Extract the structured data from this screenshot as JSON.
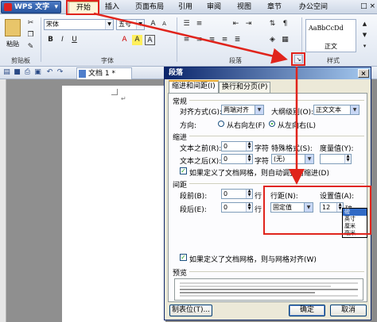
{
  "app": {
    "name": "WPS 文字",
    "caret": "▾"
  },
  "menu": {
    "tabs": [
      {
        "label": "开始",
        "active": true
      },
      {
        "label": "插入"
      },
      {
        "label": "页面布局"
      },
      {
        "label": "引用"
      },
      {
        "label": "审阅"
      },
      {
        "label": "视图"
      },
      {
        "label": "章节"
      },
      {
        "label": "办公空间"
      }
    ],
    "window_controls": "□ ×"
  },
  "ribbon": {
    "paste_label": "粘贴",
    "font_name": "宋体",
    "font_size": "五号",
    "groups": {
      "clipboard": "剪贴板",
      "font": "字体",
      "paragraph": "段落",
      "styles": "样式"
    },
    "style_sample": "AaBbCcDd",
    "style_name": "正文",
    "font_buttons": [
      "B",
      "I",
      "U",
      "A",
      "A",
      "A"
    ]
  },
  "document": {
    "tab_title": "文档 1 *",
    "mark": "↵"
  },
  "dialog": {
    "title": "段落",
    "close": "×",
    "tabs": [
      "缩进和间距(I)",
      "换行和分页(P)"
    ],
    "general": {
      "heading": "常规",
      "align_label": "对齐方式(G):",
      "align_value": "两端对齐",
      "outline_label": "大纲级别(O):",
      "outline_value": "正文文本",
      "direction_label": "方向:",
      "rtl_label": "从右向左(F)",
      "ltr_label": "从左向右(L)"
    },
    "indent": {
      "heading": "缩进",
      "before_label": "文本之前(R):",
      "before_value": "0",
      "after_label": "文本之后(X):",
      "after_value": "0",
      "unit": "字符",
      "special_label": "特殊格式(S):",
      "special_value": "(无)",
      "measure_label": "度量值(Y):",
      "auto_adjust_label": "如果定义了文档网格，则自动调整右缩进(D)"
    },
    "spacing": {
      "heading": "间距",
      "before_label": "段前(B):",
      "before_value": "0",
      "after_label": "段后(E):",
      "after_value": "0",
      "unit": "行",
      "line_label": "行距(N):",
      "line_value": "固定值",
      "setting_label": "设置值(A):",
      "setting_value": "12",
      "setting_unit": "磅",
      "unit_options": [
        "磅",
        "英寸",
        "厘米",
        "毫米"
      ],
      "grid_align_label": "如果定义了文档网格，则与网格对齐(W)"
    },
    "preview_heading": "预览",
    "buttons": {
      "tabs": "制表位(T)...",
      "ok": "确定",
      "cancel": "取消"
    }
  },
  "colors": {
    "annotation": "#e0241c",
    "title_bar": "#0a246a"
  }
}
